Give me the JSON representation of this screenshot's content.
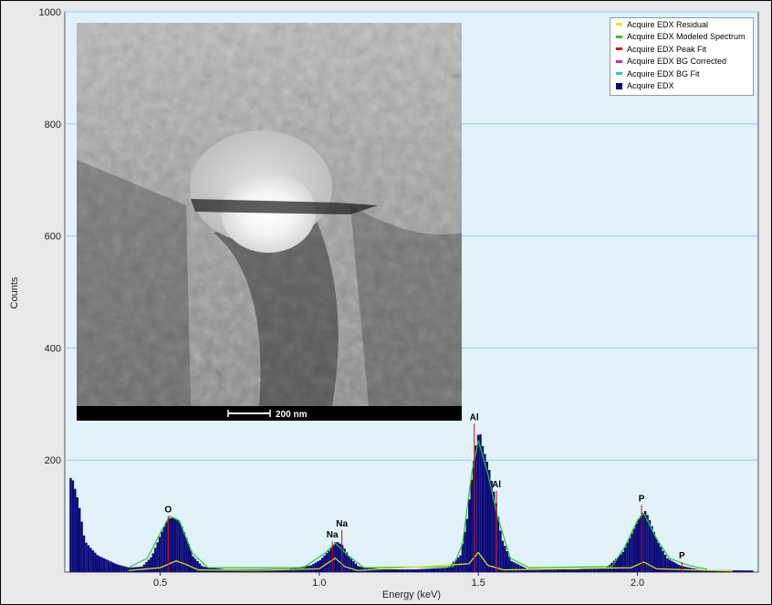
{
  "chart_data": {
    "type": "bar",
    "xlabel": "Energy (keV)",
    "ylabel": "Counts",
    "xlim": [
      0.2,
      2.38
    ],
    "ylim": [
      0,
      1000
    ],
    "x_ticks": [
      "0.5",
      "1.0",
      "1.5",
      "2.0"
    ],
    "y_ticks": [
      "200",
      "400",
      "600",
      "800",
      "1000"
    ],
    "grid": true,
    "legend_position": "top-right",
    "legend": [
      {
        "name": "Acquire EDX Residual",
        "color": "#e8e800"
      },
      {
        "name": "Acquire EDX Modeled Spectrum",
        "color": "#22cc22"
      },
      {
        "name": "Acquire EDX Peak Fit",
        "color": "#dd1111"
      },
      {
        "name": "Acquire EDX BG Corrected",
        "color": "#cc22cc"
      },
      {
        "name": "Acquire EDX BG Fit",
        "color": "#22cccc"
      },
      {
        "name": "Acquire EDX",
        "color": "#0b0b7a"
      }
    ],
    "peak_labels": [
      {
        "text": "O",
        "x": 0.525,
        "y": 100
      },
      {
        "text": "Na",
        "x": 1.041,
        "y": 55
      },
      {
        "text": "Na",
        "x": 1.071,
        "y": 75
      },
      {
        "text": "Al",
        "x": 1.487,
        "y": 265
      },
      {
        "text": "Al",
        "x": 1.557,
        "y": 145
      },
      {
        "text": "P",
        "x": 2.013,
        "y": 120
      },
      {
        "text": "P",
        "x": 2.14,
        "y": 18
      }
    ],
    "series": [
      {
        "name": "Acquire EDX",
        "type": "spectrum",
        "points": [
          [
            0.22,
            168
          ],
          [
            0.24,
            125
          ],
          [
            0.26,
            55
          ],
          [
            0.28,
            42
          ],
          [
            0.3,
            30
          ],
          [
            0.33,
            22
          ],
          [
            0.36,
            14
          ],
          [
            0.4,
            8
          ],
          [
            0.44,
            10
          ],
          [
            0.47,
            28
          ],
          [
            0.5,
            70
          ],
          [
            0.52,
            95
          ],
          [
            0.54,
            98
          ],
          [
            0.56,
            88
          ],
          [
            0.58,
            60
          ],
          [
            0.6,
            28
          ],
          [
            0.63,
            10
          ],
          [
            0.7,
            5
          ],
          [
            0.8,
            5
          ],
          [
            0.9,
            6
          ],
          [
            0.97,
            12
          ],
          [
            1.0,
            22
          ],
          [
            1.03,
            40
          ],
          [
            1.05,
            55
          ],
          [
            1.07,
            48
          ],
          [
            1.09,
            28
          ],
          [
            1.12,
            10
          ],
          [
            1.2,
            5
          ],
          [
            1.3,
            5
          ],
          [
            1.4,
            8
          ],
          [
            1.44,
            30
          ],
          [
            1.46,
            90
          ],
          [
            1.48,
            190
          ],
          [
            1.49,
            230
          ],
          [
            1.5,
            255
          ],
          [
            1.51,
            225
          ],
          [
            1.53,
            185
          ],
          [
            1.55,
            130
          ],
          [
            1.57,
            60
          ],
          [
            1.6,
            20
          ],
          [
            1.65,
            6
          ],
          [
            1.8,
            5
          ],
          [
            1.9,
            8
          ],
          [
            1.95,
            35
          ],
          [
            1.98,
            70
          ],
          [
            2.0,
            95
          ],
          [
            2.02,
            110
          ],
          [
            2.03,
            100
          ],
          [
            2.06,
            55
          ],
          [
            2.09,
            25
          ],
          [
            2.13,
            12
          ],
          [
            2.16,
            8
          ],
          [
            2.2,
            4
          ],
          [
            2.35,
            3
          ]
        ]
      },
      {
        "name": "Acquire EDX Modeled Spectrum",
        "type": "line",
        "points": [
          [
            0.4,
            8
          ],
          [
            0.46,
            25
          ],
          [
            0.5,
            70
          ],
          [
            0.53,
            100
          ],
          [
            0.56,
            92
          ],
          [
            0.6,
            35
          ],
          [
            0.65,
            8
          ],
          [
            0.95,
            8
          ],
          [
            1.02,
            35
          ],
          [
            1.05,
            52
          ],
          [
            1.09,
            30
          ],
          [
            1.14,
            8
          ],
          [
            1.42,
            10
          ],
          [
            1.45,
            50
          ],
          [
            1.48,
            180
          ],
          [
            1.5,
            235
          ],
          [
            1.53,
            175
          ],
          [
            1.56,
            100
          ],
          [
            1.6,
            25
          ],
          [
            1.66,
            8
          ],
          [
            1.92,
            10
          ],
          [
            1.96,
            45
          ],
          [
            2.0,
            92
          ],
          [
            2.02,
            105
          ],
          [
            2.06,
            60
          ],
          [
            2.1,
            25
          ],
          [
            2.16,
            12
          ],
          [
            2.22,
            5
          ]
        ]
      },
      {
        "name": "Acquire EDX Residual",
        "type": "line",
        "points": [
          [
            0.4,
            3
          ],
          [
            0.5,
            8
          ],
          [
            0.55,
            20
          ],
          [
            0.58,
            14
          ],
          [
            0.62,
            4
          ],
          [
            0.8,
            3
          ],
          [
            1.0,
            6
          ],
          [
            1.05,
            25
          ],
          [
            1.08,
            10
          ],
          [
            1.12,
            3
          ],
          [
            1.47,
            15
          ],
          [
            1.5,
            35
          ],
          [
            1.53,
            12
          ],
          [
            1.58,
            4
          ],
          [
            1.98,
            8
          ],
          [
            2.02,
            18
          ],
          [
            2.06,
            6
          ],
          [
            2.3,
            2
          ]
        ]
      }
    ]
  },
  "inset": {
    "scale_bar_label": "200 nm"
  }
}
